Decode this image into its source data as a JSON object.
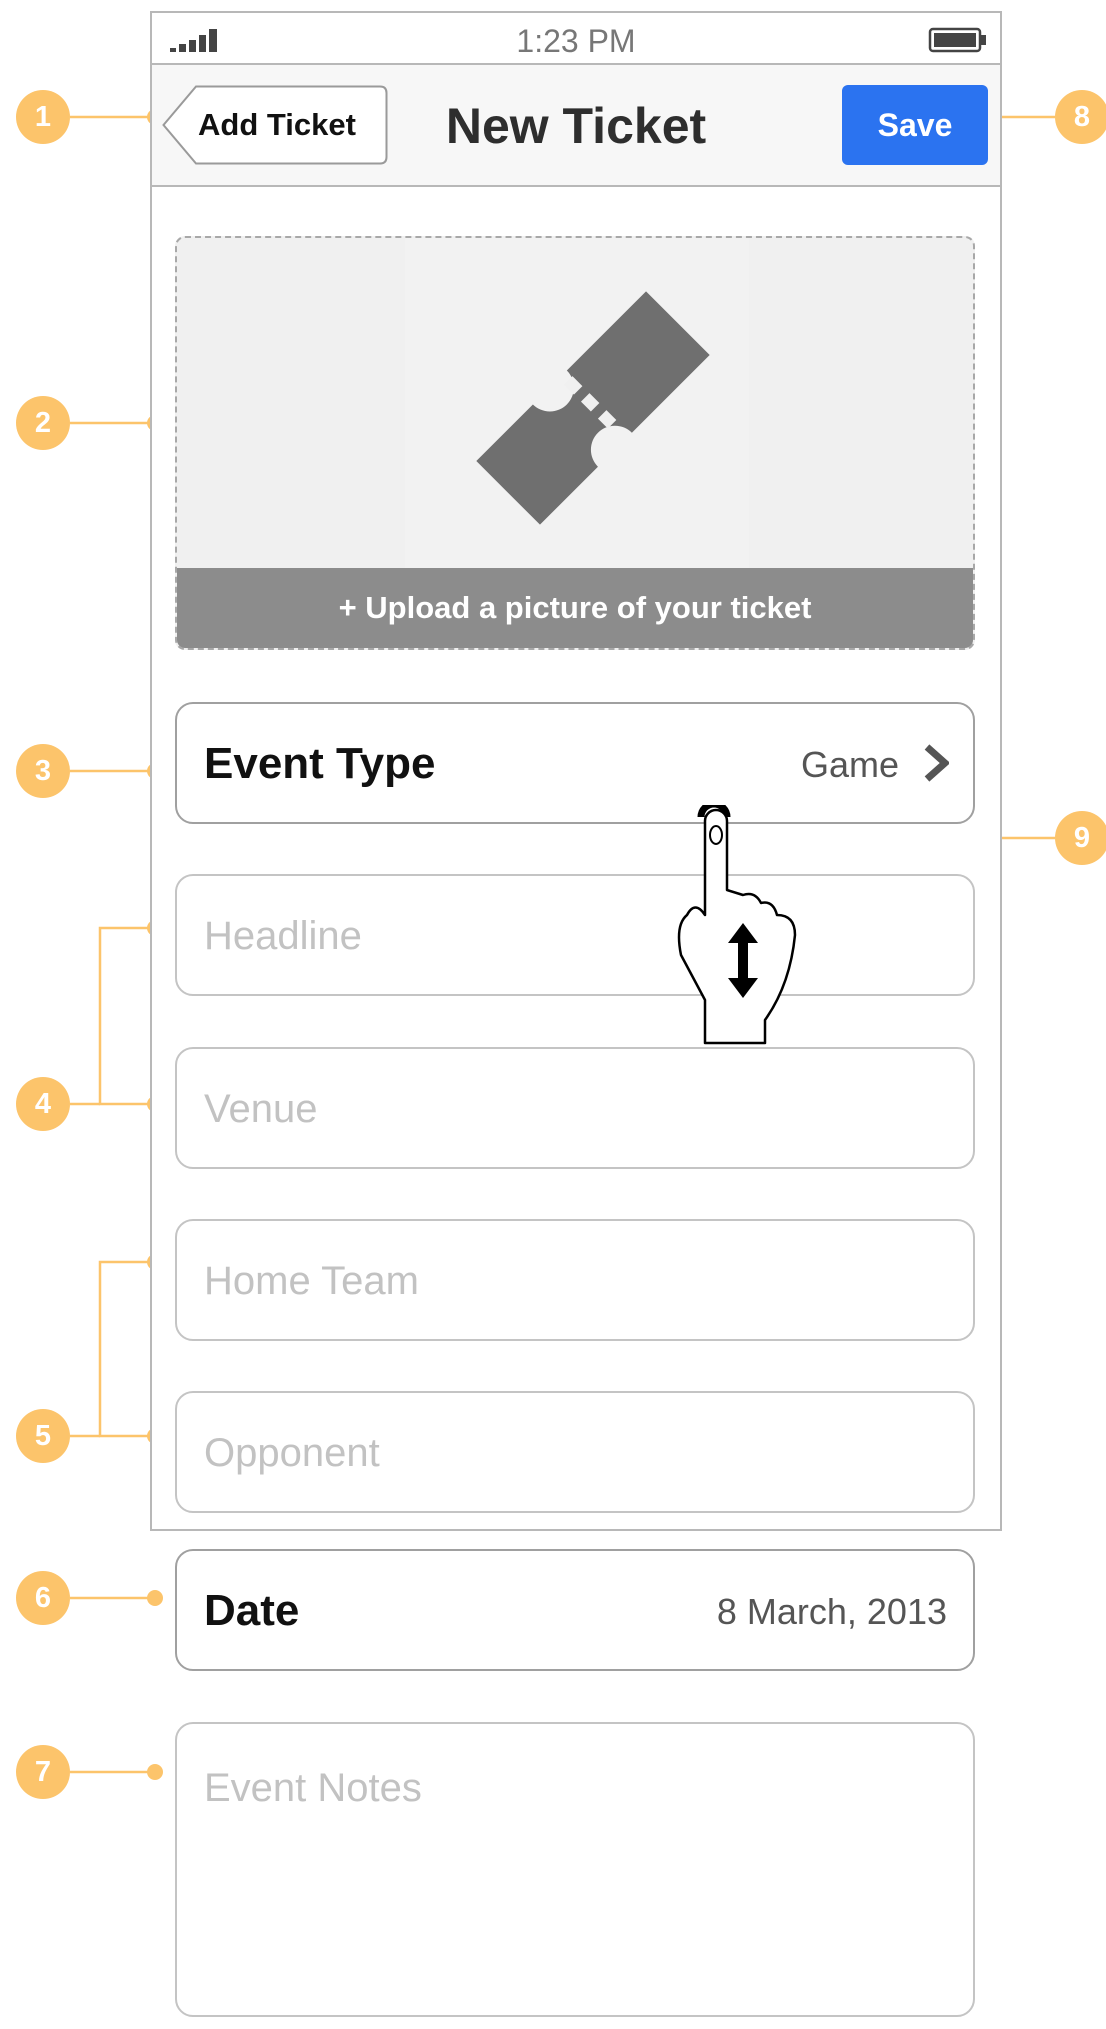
{
  "status_bar": {
    "time": "1:23 PM",
    "signal_icon": "signal-bars-icon",
    "battery_icon": "battery-full-icon"
  },
  "nav": {
    "back_label": "Add Ticket",
    "title": "New Ticket",
    "save_label": "Save",
    "save_color": "#2b73f0"
  },
  "upload": {
    "icon": "ticket-icon",
    "label": "+ Upload a picture of your ticket"
  },
  "form": {
    "event_type": {
      "label": "Event Type",
      "value": "Game",
      "icon": "chevron-right-icon"
    },
    "headline": {
      "placeholder": "Headline",
      "value": ""
    },
    "venue": {
      "placeholder": "Venue",
      "value": ""
    },
    "home_team": {
      "placeholder": "Home Team",
      "value": ""
    },
    "opponent": {
      "placeholder": "Opponent",
      "value": ""
    },
    "date": {
      "label": "Date",
      "value": "8 March, 2013"
    },
    "event_notes": {
      "placeholder": "Event Notes",
      "value": ""
    }
  },
  "annotations": {
    "color": "#fcc46b",
    "markers": [
      "1",
      "2",
      "3",
      "4",
      "5",
      "6",
      "7",
      "8",
      "9"
    ]
  },
  "gesture": {
    "icon": "hand-drag-vertical-icon"
  }
}
